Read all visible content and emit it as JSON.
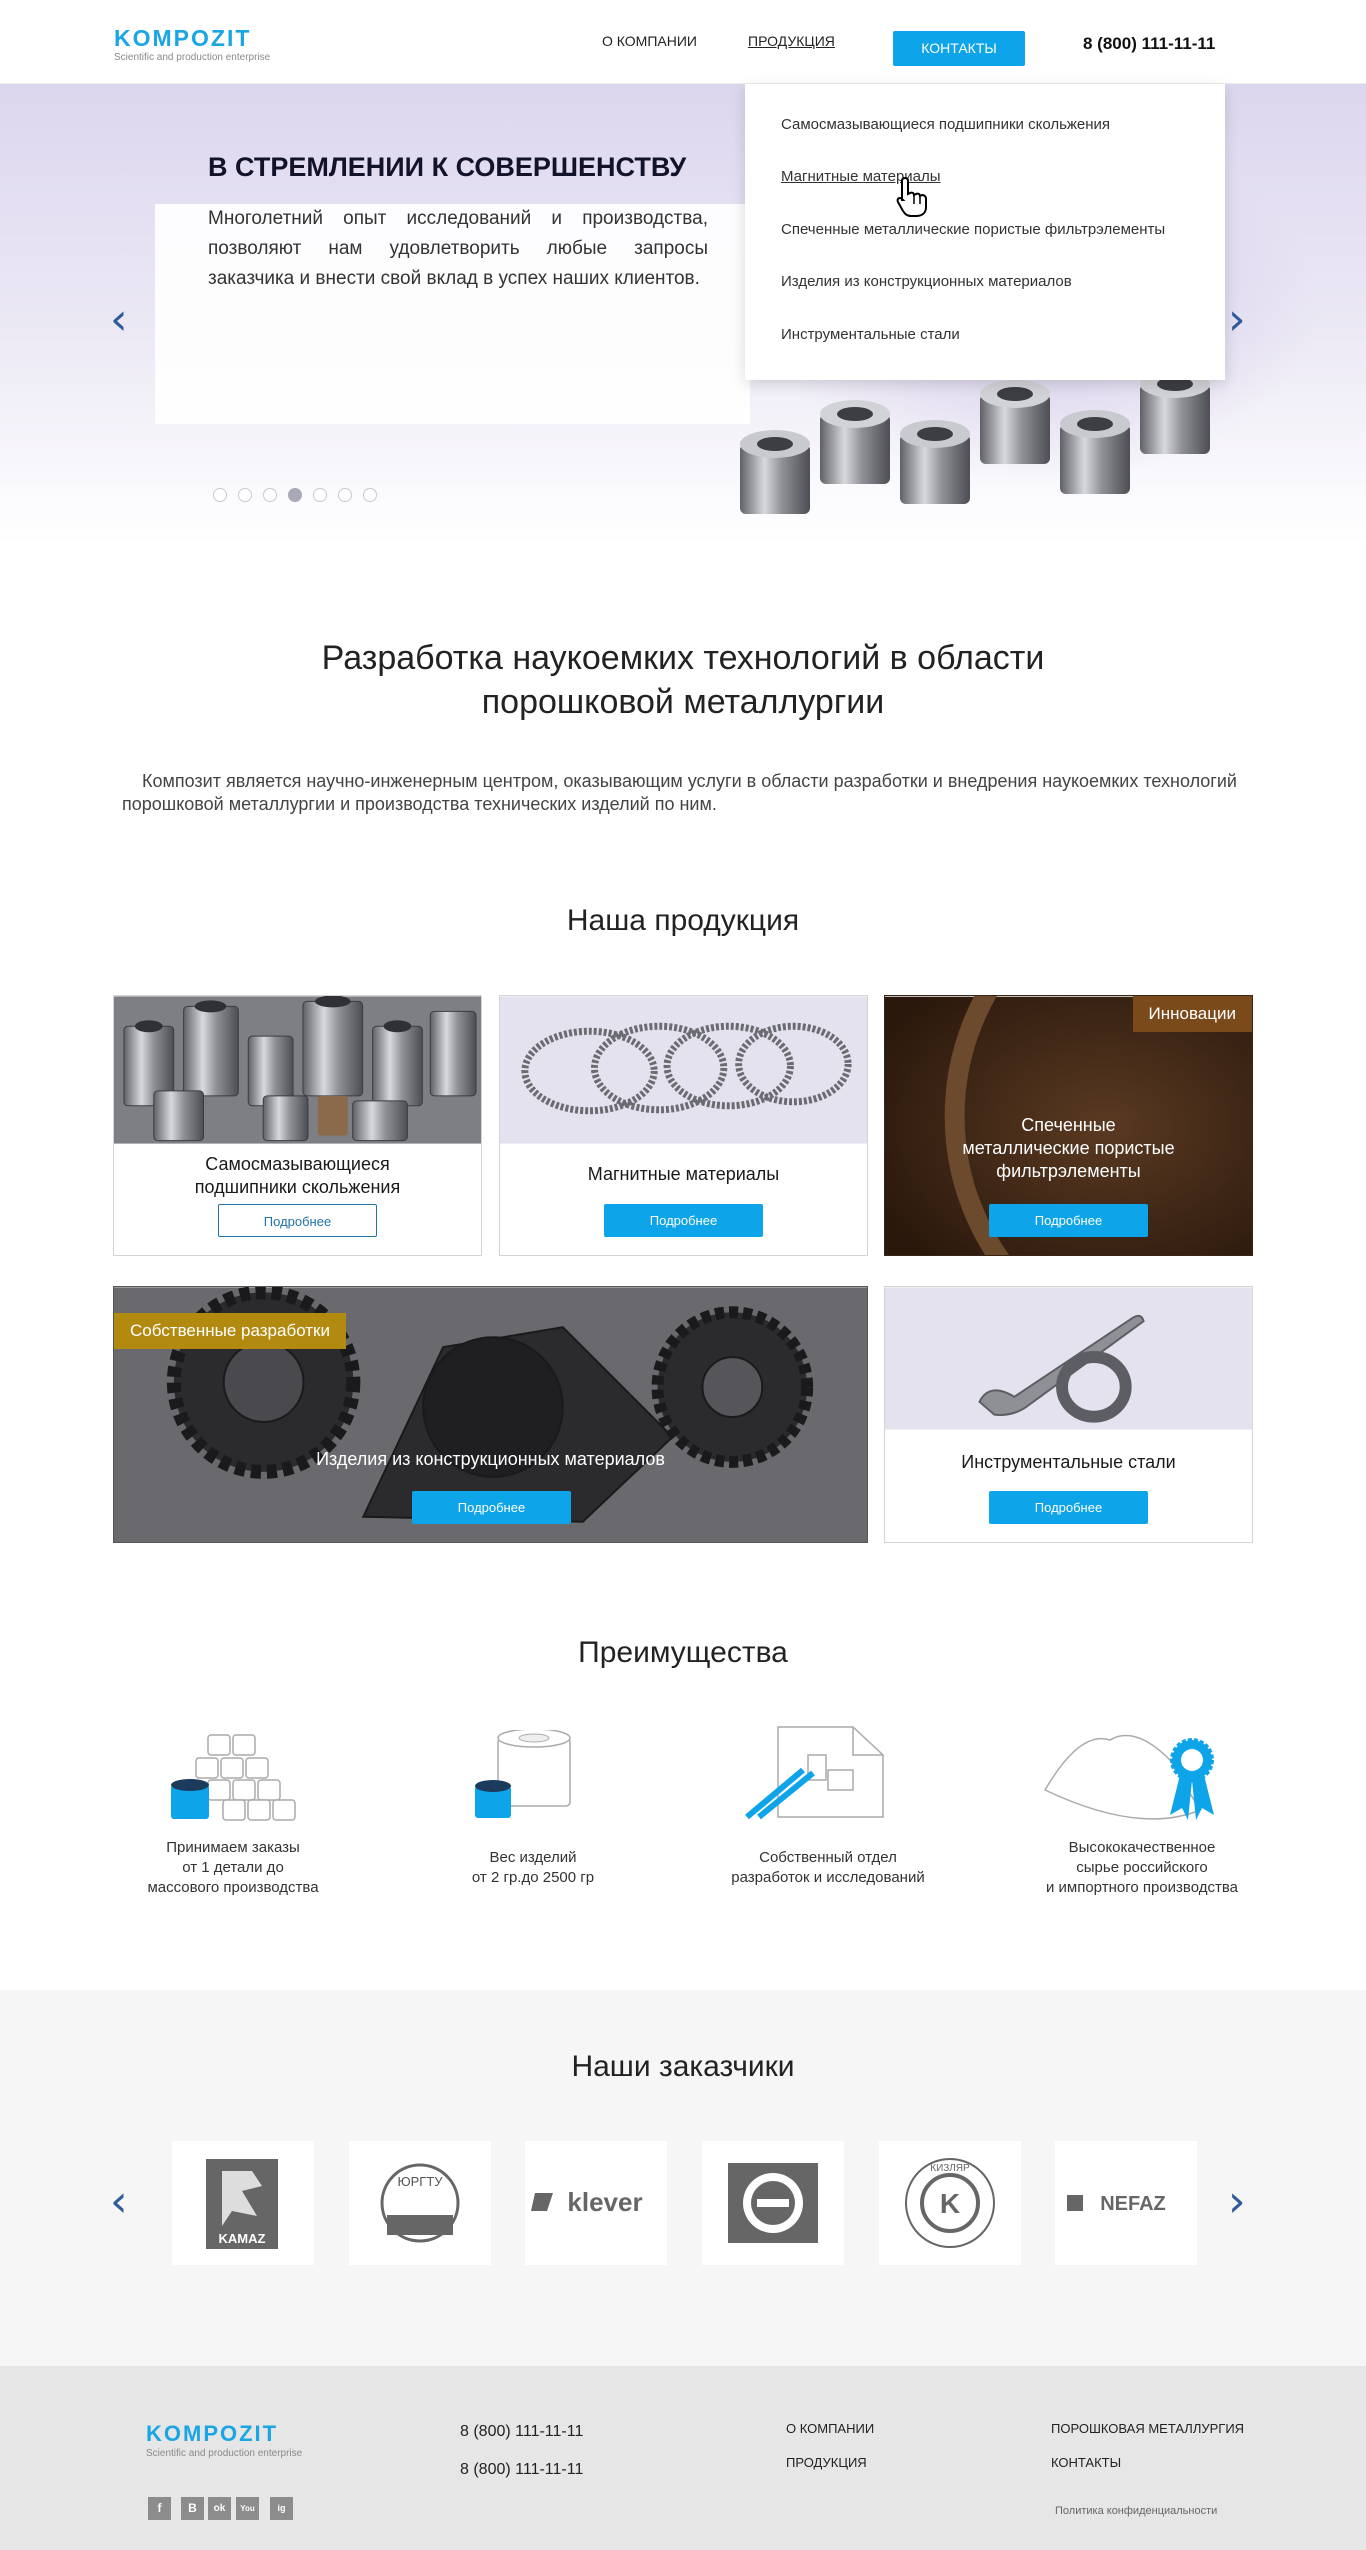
{
  "header": {
    "logo": "KOMPOZIT",
    "logo_sub": "Scientific and production enterprise",
    "nav_about": "О КОМПАНИИ",
    "nav_products": "ПРОДУКЦИЯ",
    "contacts_button": "КОНТАКТЫ",
    "phone": "8 (800) 111-11-11"
  },
  "dropdown": {
    "items": [
      "Самосмазывающиеся подшипники скольжения",
      "Магнитные  материалы",
      "Спеченные металлические пористые фильтрэлементы",
      "Изделия из конструкционных материалов",
      "Инструментальные стали"
    ]
  },
  "hero": {
    "title": "В СТРЕМЛЕНИИ К СОВЕРШЕНСТВУ",
    "text": "Многолетний опыт исследований и производства, позволяют нам удовлетворить любые запросы заказчика и внести свой вклад в успех наших клиентов.",
    "prev_arrow": "‹",
    "next_arrow": "›",
    "slide_count": 7,
    "active_slide": 4
  },
  "intro": {
    "title_line1": "Разработка наукоемких технологий в области",
    "title_line2": "порошковой металлургии",
    "text": "Композит является научно-инженерным центром, оказывающим услуги в области разработки и внедрения наукоемких технологий порошковой металлургии и производства технических изделий по ним."
  },
  "products": {
    "title": "Наша продукция",
    "more": "Подробнее",
    "cards": [
      {
        "title_line1": "Самосмазывающиеся",
        "title_line2": "подшипники скольжения"
      },
      {
        "title": "Магнитные  материалы"
      },
      {
        "title_line1": "Спеченные",
        "title_line2": "металлические пористые",
        "title_line3": "фильтрэлементы",
        "badge": "Инновации"
      },
      {
        "title": "Изделия из конструкционных материалов",
        "badge": "Собственные разработки"
      },
      {
        "title": "Инструментальные стали"
      }
    ],
    "badge_colors": {
      "innovations": "#7a4a1a",
      "own": "#b38a10"
    }
  },
  "advantages": {
    "title": "Преимущества",
    "items": [
      {
        "line1": "Принимаем заказы",
        "line2": "от 1 детали до",
        "line3": "массового производства"
      },
      {
        "line1": "Вес изделий",
        "line2": "от 2 гр.до 2500 гр"
      },
      {
        "line1": "Собственный отдел",
        "line2": "разработок и исследований"
      },
      {
        "line1": "Высококачественное",
        "line2": "сырье российского",
        "line3": "и импортного производства"
      }
    ]
  },
  "clients": {
    "title": "Наши заказчики",
    "prev_arrow": "‹",
    "next_arrow": "›",
    "logos": [
      {
        "name": "kamaz-logo",
        "text": "KAMAZ"
      },
      {
        "name": "yurgtu-logo",
        "text": "ЮРГТУ"
      },
      {
        "name": "klever-logo",
        "text": "klever"
      },
      {
        "name": "emblem-logo",
        "text": ""
      },
      {
        "name": "kizlyar-logo",
        "text": "КИЗЛЯР"
      },
      {
        "name": "nefaz-logo",
        "text": "NEFAZ"
      }
    ]
  },
  "footer": {
    "logo": "KOMPOZIT",
    "logo_sub": "Scientific and production enterprise",
    "phone1": "8 (800) 111-11-11",
    "phone2": "8 (800) 111-11-11",
    "link_about": "О КОМПАНИИ",
    "link_products": "ПРОДУКЦИЯ",
    "link_metallurgy": "ПОРОШКОВАЯ МЕТАЛЛУРГИЯ",
    "link_contacts": "КОНТАКТЫ",
    "policy": "Политика конфиденциальности",
    "social": [
      "f",
      "В",
      "ok",
      "You",
      "ig"
    ]
  },
  "colors": {
    "accent": "#0ea4ea",
    "brand_logo": "#1aa6e4",
    "arrow": "#2e5b9b"
  }
}
